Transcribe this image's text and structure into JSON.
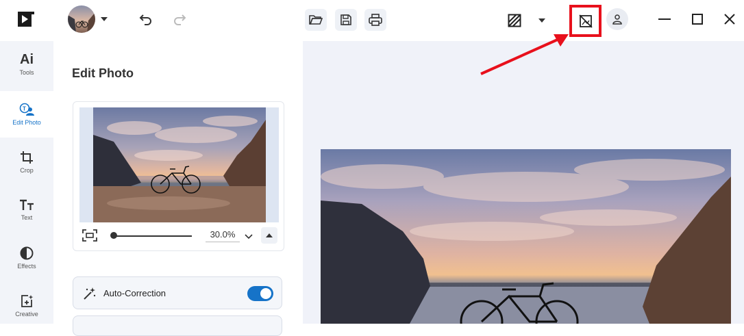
{
  "topbar": {
    "logo_icon": "video-play-logo-icon",
    "avatar_icon": "profile-photo",
    "toolbar_icons": [
      "undo-icon",
      "redo-icon",
      "open-folder-icon",
      "save-icon",
      "print-icon",
      "compare-view-icon",
      "hide-original-icon",
      "user-icon",
      "minimize-icon",
      "maximize-icon",
      "close-icon"
    ],
    "highlight_color": "#e8101c"
  },
  "rail": {
    "items": [
      {
        "label": "Tools",
        "icon": "ai-icon",
        "glyph": "Ai"
      },
      {
        "label": "Edit Photo",
        "icon": "edit-photo-icon"
      },
      {
        "label": "Crop",
        "icon": "crop-icon"
      },
      {
        "label": "Text",
        "icon": "text-icon"
      },
      {
        "label": "Effects",
        "icon": "effects-icon"
      },
      {
        "label": "Creative",
        "icon": "creative-icon"
      }
    ],
    "active_color": "#1673c8"
  },
  "panel": {
    "title": "Edit Photo",
    "zoom": {
      "value": "30.0%",
      "slider_level_fraction": 0.0
    },
    "auto_correction": {
      "label": "Auto-Correction",
      "enabled": true
    }
  },
  "colors": {
    "accent": "#1673c8",
    "canvas_bg": "#f0f2f9",
    "rail_bg": "#f2f4f9"
  }
}
